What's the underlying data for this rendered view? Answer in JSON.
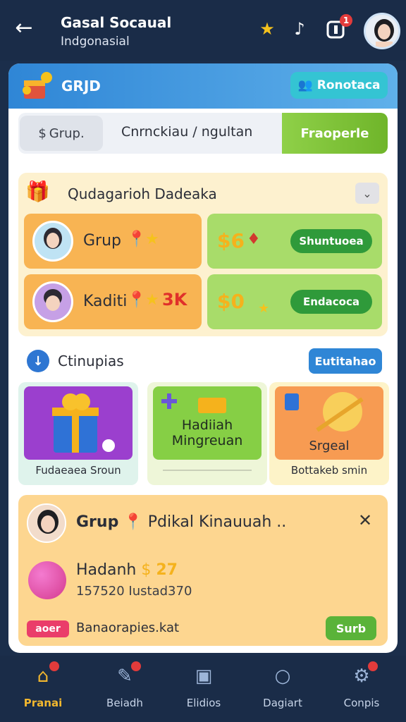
{
  "topbar": {
    "title": "Gasal Socaual",
    "subtitle": "Indgonasial",
    "notification_count": "1"
  },
  "card": {
    "title": "GRJD",
    "action_label": "Ronotaca"
  },
  "tabs": {
    "active": "Grup.",
    "middle": "Cnrnckiau / ngultan",
    "green": "Fraoperle"
  },
  "daily": {
    "title": "Qudagarioh Dadeaka",
    "rows": [
      {
        "name": "Grup",
        "price": "$6",
        "button": "Shuntuoea"
      },
      {
        "name": "Kaditi",
        "highlight": "3K",
        "price": "$0",
        "button": "Endacoca"
      }
    ]
  },
  "contrib": {
    "title": "Ctinupias",
    "button": "Eutitahao"
  },
  "tiles": [
    {
      "label": "Fudaeaea Sroun"
    },
    {
      "heading_1": "Hadiiah",
      "heading_2": "Mingreuan"
    },
    {
      "heading": "Srgeal",
      "label": "Bottakeb smin"
    }
  ],
  "post": {
    "title_bold": "Grup",
    "title_rest": "Pdikal Kinauuah ..",
    "reward": "Hadanh",
    "reward_amount": "27",
    "stats": "157520   Iustad370",
    "tag": "aoer",
    "note": "Banaorapies.kat",
    "button": "Surb"
  },
  "nav": [
    {
      "label": "Pranai",
      "active": true
    },
    {
      "label": "Beiadh"
    },
    {
      "label": "Elidios"
    },
    {
      "label": "Dagiart"
    },
    {
      "label": "Conpis"
    }
  ],
  "colors": {
    "header_bg": "#1a2c48",
    "accent_blue": "#2f86d6",
    "accent_green": "#6fb52a",
    "accent_orange": "#f8b453",
    "active_nav": "#f2b72e"
  }
}
